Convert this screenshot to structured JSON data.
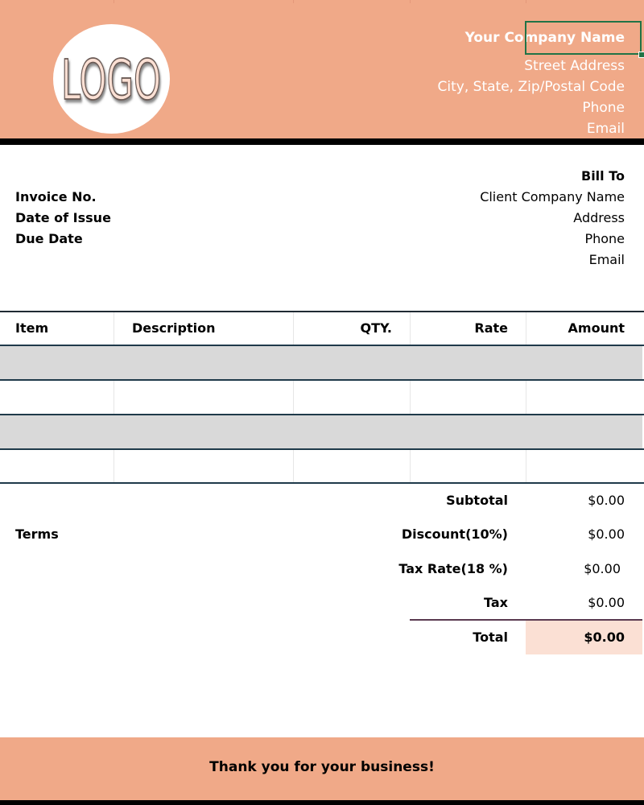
{
  "colors": {
    "header_band": "#f0a988",
    "selection_border": "#217346",
    "row_fill": "#d9d9d9",
    "total_highlight": "#fbe0d4"
  },
  "header": {
    "logo_text": "LOGO",
    "company_name": "Your Company Name",
    "street_address": "Street Address",
    "city_state_zip": "City, State, Zip/Postal Code",
    "phone": "Phone",
    "email": "Email"
  },
  "invoice": {
    "invoice_no_label": "Invoice No.",
    "date_of_issue_label": "Date of Issue",
    "due_date_label": "Due Date"
  },
  "bill_to": {
    "title": "Bill To",
    "client_company": "Client Company Name",
    "address": "Address",
    "phone": "Phone",
    "email": "Email"
  },
  "table": {
    "headers": {
      "item": "Item",
      "description": "Description",
      "qty": "QTY.",
      "rate": "Rate",
      "amount": "Amount"
    },
    "rows": [
      {
        "item": "",
        "description": "",
        "qty": "",
        "rate": "",
        "amount": ""
      },
      {
        "item": "",
        "description": "",
        "qty": "",
        "rate": "",
        "amount": ""
      },
      {
        "item": "",
        "description": "",
        "qty": "",
        "rate": "",
        "amount": ""
      },
      {
        "item": "",
        "description": "",
        "qty": "",
        "rate": "",
        "amount": ""
      }
    ]
  },
  "terms_label": "Terms",
  "summary": {
    "subtotal_label": "Subtotal",
    "subtotal_value": "$0.00",
    "discount_label": "Discount(10%)",
    "discount_value": "$0.00",
    "tax_rate_label": "Tax Rate(18 %)",
    "tax_rate_value": "$0.00",
    "tax_label": "Tax",
    "tax_value": "$0.00",
    "total_label": "Total",
    "total_value": "$0.00"
  },
  "footer": {
    "thank_you": "Thank you for your business!"
  }
}
